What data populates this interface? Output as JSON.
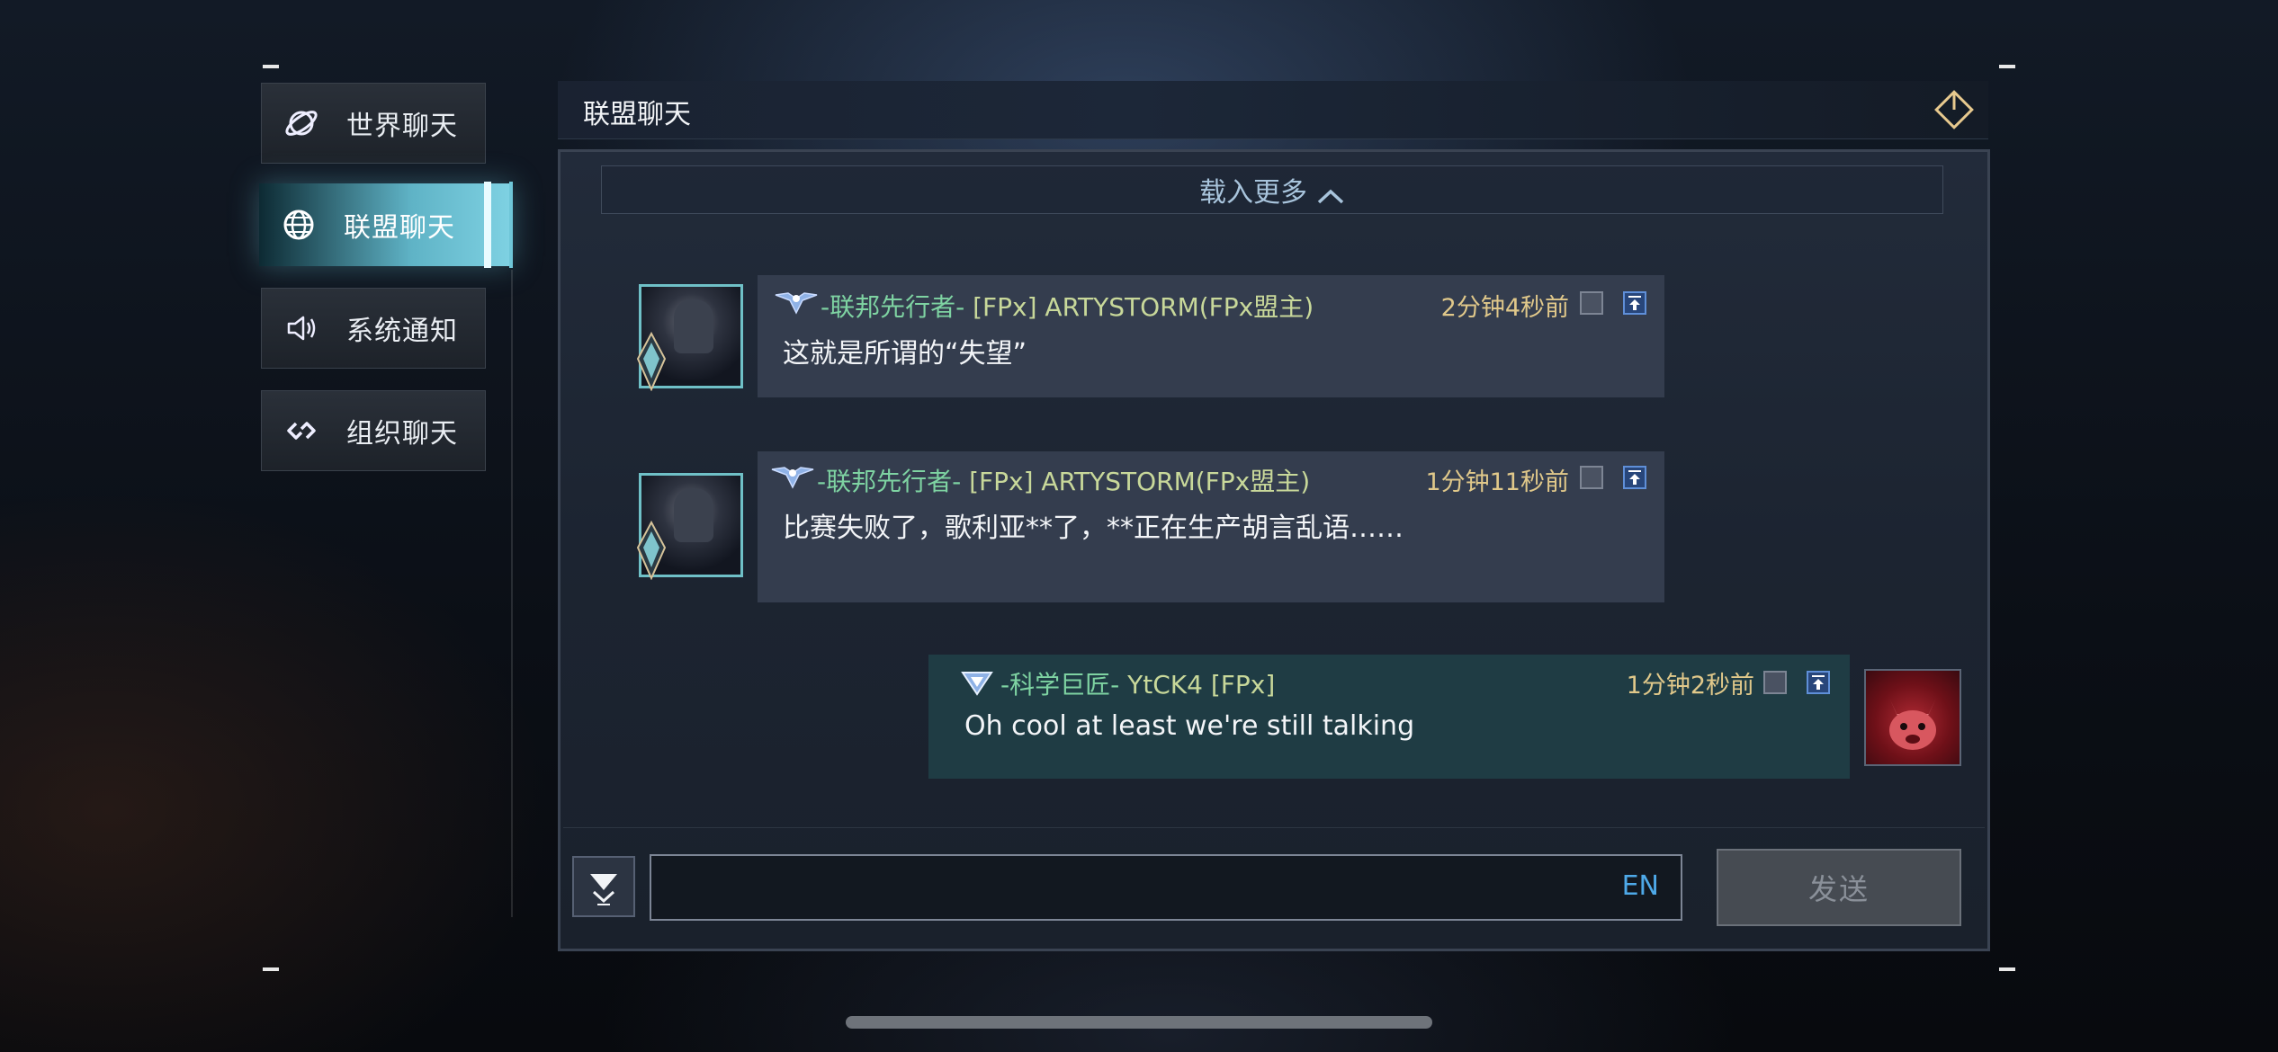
{
  "sidebar": {
    "items": [
      {
        "label": "世界聊天",
        "icon": "planet-icon"
      },
      {
        "label": "联盟聊天",
        "icon": "globe-icon",
        "active": true
      },
      {
        "label": "系统通知",
        "icon": "speaker-icon"
      },
      {
        "label": "组织聊天",
        "icon": "link-icon"
      }
    ]
  },
  "header": {
    "title": "联盟聊天",
    "icon": "power-icon"
  },
  "load_more": {
    "label": "载入更多"
  },
  "messages": [
    {
      "title_badge": "-联邦先行者-",
      "name": "[FPx] ARTYSTORM(FPx盟主)",
      "time": "2分钟4秒前",
      "text": "这就是所谓的“失望”"
    },
    {
      "title_badge": "-联邦先行者-",
      "name": "[FPx] ARTYSTORM(FPx盟主)",
      "time": "1分钟11秒前",
      "text": "比赛失败了，歌利亚**了，**正在生产胡言乱语……"
    },
    {
      "title_badge": "-科学巨匠-",
      "name": "YtCK4 [FPx]",
      "time": "1分钟2秒前",
      "text": "Oh cool at least we're still talking",
      "mine": true
    }
  ],
  "composer": {
    "lang": "EN",
    "send_label": "发送"
  },
  "colors": {
    "accent": "#6fc6d8",
    "title_green": "#7ed3a2",
    "time_gold": "#e0c88a",
    "lang_blue": "#4ea9e8"
  }
}
